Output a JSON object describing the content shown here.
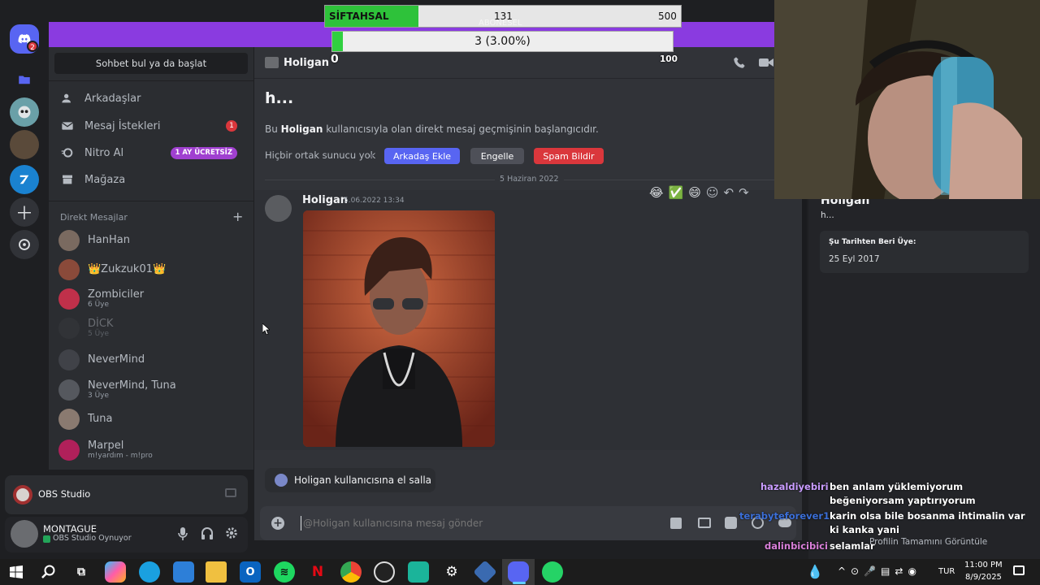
{
  "goal_bar": {
    "label": "SİFTAHSAL",
    "current": "131",
    "target": "500",
    "overlay_label": "ABONESEL",
    "fill_fraction": 0.262
  },
  "sub_bar": {
    "value_text": "3 (3.00%)",
    "min": "0",
    "max": "100",
    "fill_fraction": 0.03
  },
  "servers": {
    "discord_badge": "2"
  },
  "dm_panel": {
    "search_label": "Sohbet bul ya da başlat",
    "nav": [
      {
        "label": "Arkadaşlar",
        "icon": "friends-icon"
      },
      {
        "label": "Mesaj İstekleri",
        "icon": "mail-icon",
        "badge": "1"
      },
      {
        "label": "Nitro Al",
        "icon": "nitro-icon",
        "badge": "1 AY ÜCRETSİZ"
      },
      {
        "label": "Mağaza",
        "icon": "shop-icon"
      }
    ],
    "direct_header": "Direkt Mesajlar",
    "dms": [
      {
        "name": "HanHan",
        "sub": "",
        "color": "#7a6a60"
      },
      {
        "name": "👑Zukzuk01👑",
        "sub": "",
        "color": "#8a4a3a"
      },
      {
        "name": "Zombiciler",
        "sub": "6 Üye",
        "color": "#c0304a"
      },
      {
        "name": "DİCK",
        "sub": "5 Üye",
        "color": "#3a3c40"
      },
      {
        "name": "NeverMind",
        "sub": "",
        "color": "#404248"
      },
      {
        "name": "NeverMind, Tuna",
        "sub": "3 Üye",
        "color": "#55585e"
      },
      {
        "name": "Tuna",
        "sub": "",
        "color": "#8a7a70"
      },
      {
        "name": "Marpel",
        "sub": "m!yardım - m!pro",
        "color": "#b0205a"
      }
    ],
    "activity": {
      "name": "OBS Studio"
    },
    "user": {
      "name": "MONTAGUE",
      "status": "OBS Studio Oynuyor"
    }
  },
  "chat": {
    "header_name": "Holigan",
    "big_title": "h...",
    "intro_pre": "Bu ",
    "intro_name": "Holigan",
    "intro_post": " kullanıcısıyla olan direkt mesaj geçmişinin başlangıcıdır.",
    "no_mutual": "Hiçbir ortak sunucu yok",
    "add_friend": "Arkadaş Ekle",
    "block": "Engelle",
    "report": "Spam Bildir",
    "divider_date": "5 Haziran 2022",
    "message": {
      "author": "Holigan",
      "time": "5.06.2022 13:34"
    },
    "wave": "Holigan kullanıcısına el salla",
    "input_placeholder": "@Holigan kullanıcısına mesaj gönder"
  },
  "profile": {
    "name": "Holigan",
    "sub": "h...",
    "member_since_label": "Şu Tarihten Beri Üye:",
    "member_since": "25 Eyl 2017",
    "full_profile": "Profilin Tamamını Görüntüle"
  },
  "stream_chat": [
    {
      "user": "hazaldiyebiri",
      "user_color": "#c99cff",
      "text": "ben anlam yüklemiyorum beğeniyorsam yaptırıyorum"
    },
    {
      "user": "terabyteforever1",
      "user_color": "#3b6fd8",
      "text": "karin olsa bile bosanma ihtimalin var ki kanka yani"
    },
    {
      "user": "dalinbicibici",
      "user_color": "#d97fd9",
      "text": "selamlar"
    }
  ],
  "taskbar": {
    "lang": "TUR",
    "time": "11:00 PM",
    "date": "8/9/2025"
  },
  "colors": {
    "blurple": "#5865f2",
    "red": "#da373c",
    "green": "#23a559",
    "overlay_purple": "#8a3be0"
  }
}
